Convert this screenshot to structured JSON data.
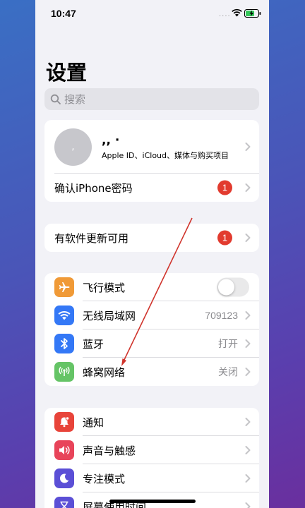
{
  "status_bar": {
    "time": "10:47",
    "signal": "····"
  },
  "page": {
    "title": "设置"
  },
  "search": {
    "placeholder": "搜索"
  },
  "profile": {
    "avatar_text": ",",
    "name": ",, ·",
    "subtitle": "Apple ID、iCloud、媒体与购买项目"
  },
  "account": {
    "confirm_password_label": "确认iPhone密码",
    "badge": "1"
  },
  "update": {
    "label": "有软件更新可用",
    "badge": "1"
  },
  "connectivity": {
    "items": [
      {
        "label": "飞行模式",
        "icon": "airplane-icon",
        "color": "#f09a37"
      },
      {
        "label": "无线局域网",
        "value": "709123",
        "icon": "wifi-icon",
        "color": "#3478f6"
      },
      {
        "label": "蓝牙",
        "value": "打开",
        "icon": "bluetooth-icon",
        "color": "#3478f6"
      },
      {
        "label": "蜂窝网络",
        "value": "关闭",
        "icon": "cellular-icon",
        "color": "#65c466"
      }
    ],
    "airplane_on": false
  },
  "notifications": {
    "items": [
      {
        "label": "通知",
        "icon": "bell-icon",
        "color": "#e8443a"
      },
      {
        "label": "声音与触感",
        "icon": "speaker-icon",
        "color": "#e8445a"
      },
      {
        "label": "专注模式",
        "icon": "moon-icon",
        "color": "#5b4fd6"
      },
      {
        "label": "屏幕使用时间",
        "icon": "hourglass-icon",
        "color": "#5b4fd6"
      }
    ]
  }
}
